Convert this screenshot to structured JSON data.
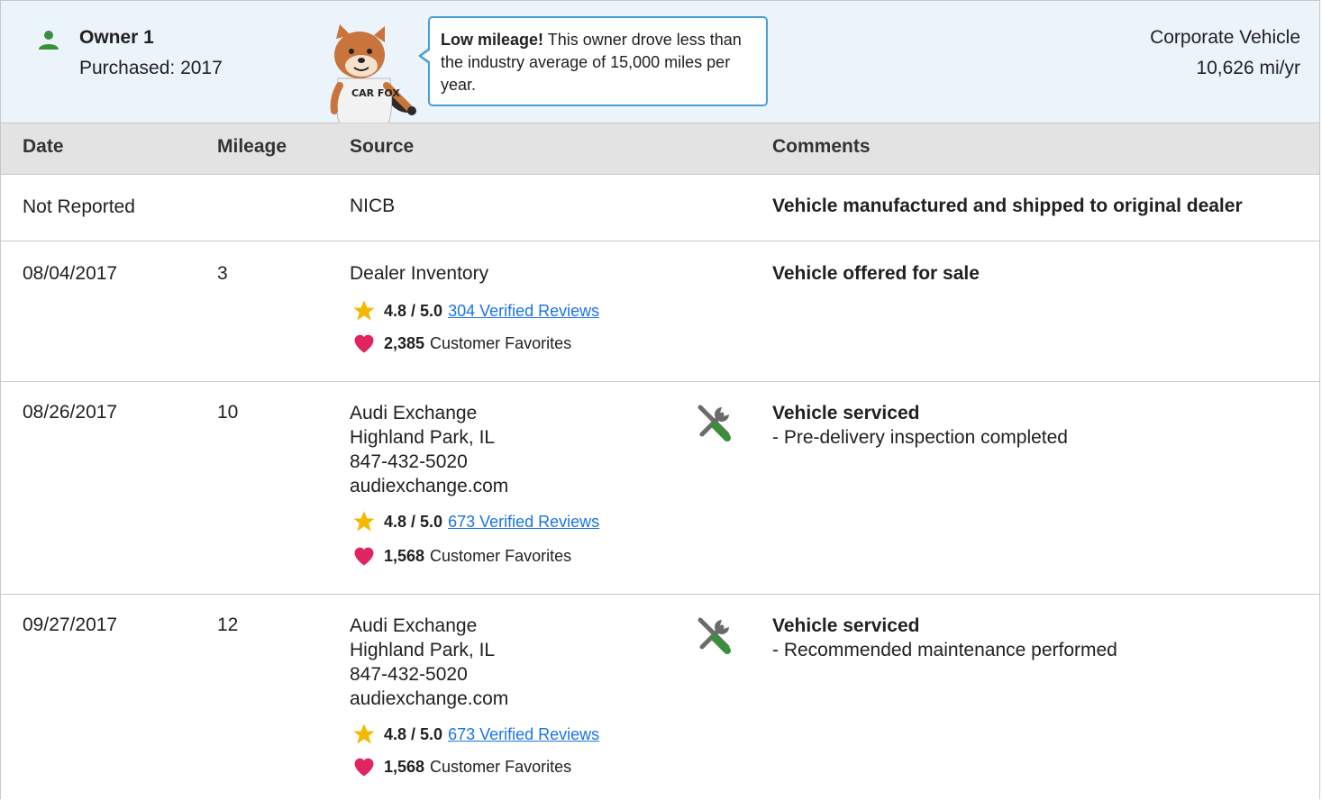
{
  "owner": {
    "name": "Owner 1",
    "purchased": "Purchased: 2017",
    "type": "Corporate Vehicle",
    "miles_per_year": "10,626 mi/yr",
    "bubble_bold": "Low mileage!",
    "bubble_text": " This owner drove less than the industry average of 15,000 miles per year.",
    "fox_shirt": "CAR FOX"
  },
  "table": {
    "headers": {
      "date": "Date",
      "mileage": "Mileage",
      "source": "Source",
      "comments": "Comments"
    },
    "rows": [
      {
        "date": "Not Reported",
        "mileage": "",
        "source_lines": [
          "NICB"
        ],
        "comment_title": "Vehicle manufactured and shipped to original dealer",
        "comment_detail": ""
      },
      {
        "date": "08/04/2017",
        "mileage": "3",
        "source_lines": [
          "Dealer Inventory"
        ],
        "rating": "4.8 / 5.0",
        "reviews": "304 Verified Reviews",
        "favorites_count": "2,385",
        "favorites_label": "Customer Favorites",
        "comment_title": "Vehicle offered for sale",
        "comment_detail": ""
      },
      {
        "date": "08/26/2017",
        "mileage": "10",
        "source_lines": [
          "Audi Exchange",
          "Highland Park, IL",
          "847-432-5020",
          "audiexchange.com"
        ],
        "rating": "4.8 / 5.0",
        "reviews": "673 Verified Reviews",
        "favorites_count": "1,568",
        "favorites_label": "Customer Favorites",
        "comment_title": "Vehicle serviced",
        "comment_detail": "- Pre-delivery inspection completed",
        "icon": "service-tools-icon"
      },
      {
        "date": "09/27/2017",
        "mileage": "12",
        "source_lines": [
          "Audi Exchange",
          "Highland Park, IL",
          "847-432-5020",
          "audiexchange.com"
        ],
        "rating": "4.8 / 5.0",
        "reviews": "673 Verified Reviews",
        "favorites_count": "1,568",
        "favorites_label": "Customer Favorites",
        "comment_title": "Vehicle serviced",
        "comment_detail": "- Recommended maintenance performed",
        "icon": "service-tools-icon"
      }
    ]
  },
  "colors": {
    "owner_bg": "#ebf3fb",
    "header_bg": "#e3e3e3",
    "link": "#1a73e8",
    "star": "#f5b800",
    "heart": "#e0245e",
    "tool_green": "#3a8f3a"
  }
}
